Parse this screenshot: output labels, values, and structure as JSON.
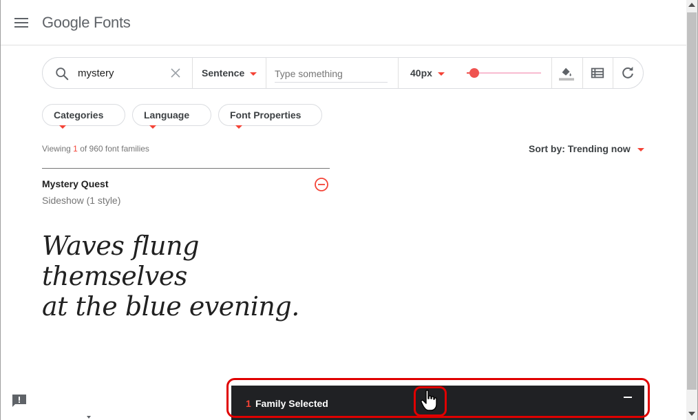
{
  "header": {
    "logo": "Google Fonts"
  },
  "toolbar": {
    "search_value": "mystery",
    "preview_mode": "Sentence",
    "type_placeholder": "Type something",
    "font_size": "40px",
    "font_size_slider_fraction": 0.1
  },
  "filters": {
    "categories": "Categories",
    "language": "Language",
    "font_properties": "Font Properties"
  },
  "results": {
    "viewing_prefix": "Viewing",
    "viewing_count": "1",
    "viewing_suffix": "of 960 font families",
    "sort_by": "Sort by: Trending now"
  },
  "font_card": {
    "name": "Mystery Quest",
    "designer": "Sideshow (1 style)",
    "sample_line1": "Waves flung themselves",
    "sample_line2": "at the blue evening."
  },
  "drawer": {
    "count": "1",
    "label": "Family Selected"
  },
  "colors": {
    "accent": "#f44336",
    "drawer_bg": "#202124",
    "annotation": "#e00000"
  },
  "icons": {
    "menu": "menu-icon",
    "search": "search-icon",
    "clear": "close-icon",
    "bg_color": "format-color-fill-icon",
    "view_list": "view-list-icon",
    "refresh": "refresh-icon",
    "remove": "remove-circle-icon",
    "feedback": "feedback-icon",
    "minimize": "minimize-icon",
    "cursor": "hand-cursor-icon"
  }
}
